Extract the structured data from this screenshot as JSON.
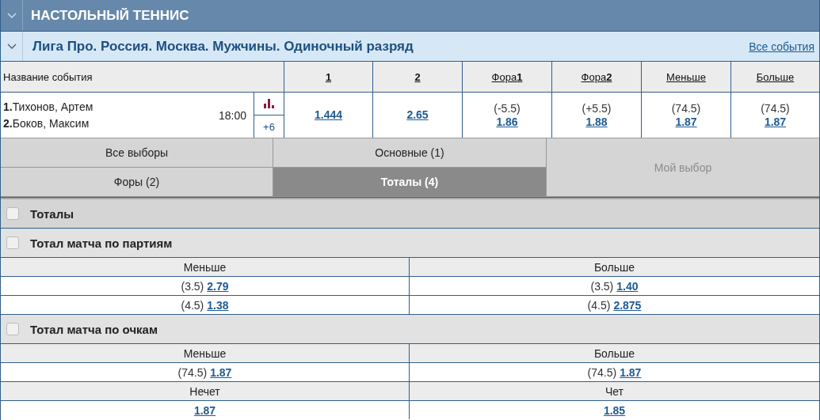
{
  "sport": {
    "title": "НАСТОЛЬНЫЙ ТЕННИС",
    "expanded": true
  },
  "league": {
    "title": "Лига Про. Россия. Москва. Мужчины. Одиночный разряд",
    "expanded": true,
    "link": "Все события"
  },
  "table": {
    "columns": [
      "Название события",
      "**1**",
      "**2**",
      "Фора**1**",
      "Фора**2**",
      "Меньше",
      "Больше"
    ]
  },
  "events": [
    {
      "players": [
        {
          "num": "1.",
          "name": "Тихонов, Артем"
        },
        {
          "num": "2.",
          "name": "Боков, Максим"
        }
      ],
      "time": "18:00",
      "more": "+6",
      "odds": [
        {
          "value": "1.444"
        },
        {
          "value": "2.65"
        },
        {
          "line": "(-5.5)",
          "value": "1.86"
        },
        {
          "line": "(+5.5)",
          "value": "1.88"
        },
        {
          "line": "(74.5)",
          "value": "1.87"
        },
        {
          "line": "(74.5)",
          "value": "1.87"
        }
      ]
    }
  ],
  "tabs": [
    {
      "label": "Все выборы",
      "selected": false,
      "disabled": false
    },
    {
      "label": "Основные (1)",
      "selected": false,
      "disabled": false
    },
    {
      "label": "Мой выбор",
      "selected": false,
      "disabled": true
    },
    {
      "label": "Форы (2)",
      "selected": false,
      "disabled": false
    },
    {
      "label": "Тоталы (4)",
      "selected": true,
      "disabled": false
    }
  ],
  "markets": [
    {
      "title": "Тоталы",
      "checked": false
    },
    {
      "title": "Тотал матча по партиям",
      "checked": false,
      "groups": [
        {
          "columns": [
            "Меньше",
            "Больше"
          ],
          "rows": [
            [
              {
                "line": "(3.5)",
                "value": "2.79"
              },
              {
                "line": "(3.5)",
                "value": "1.40"
              }
            ],
            [
              {
                "line": "(4.5)",
                "value": "1.38"
              },
              {
                "line": "(4.5)",
                "value": "2.875"
              }
            ]
          ]
        }
      ]
    },
    {
      "title": "Тотал матча по очкам",
      "checked": false,
      "groups": [
        {
          "columns": [
            "Меньше",
            "Больше"
          ],
          "rows": [
            [
              {
                "line": "(74.5)",
                "value": "1.87"
              },
              {
                "line": "(74.5)",
                "value": "1.87"
              }
            ]
          ]
        },
        {
          "columns": [
            "Нечет",
            "Чет"
          ],
          "rows": [
            [
              {
                "value": "1.87"
              },
              {
                "value": "1.85"
              }
            ]
          ]
        }
      ]
    }
  ]
}
